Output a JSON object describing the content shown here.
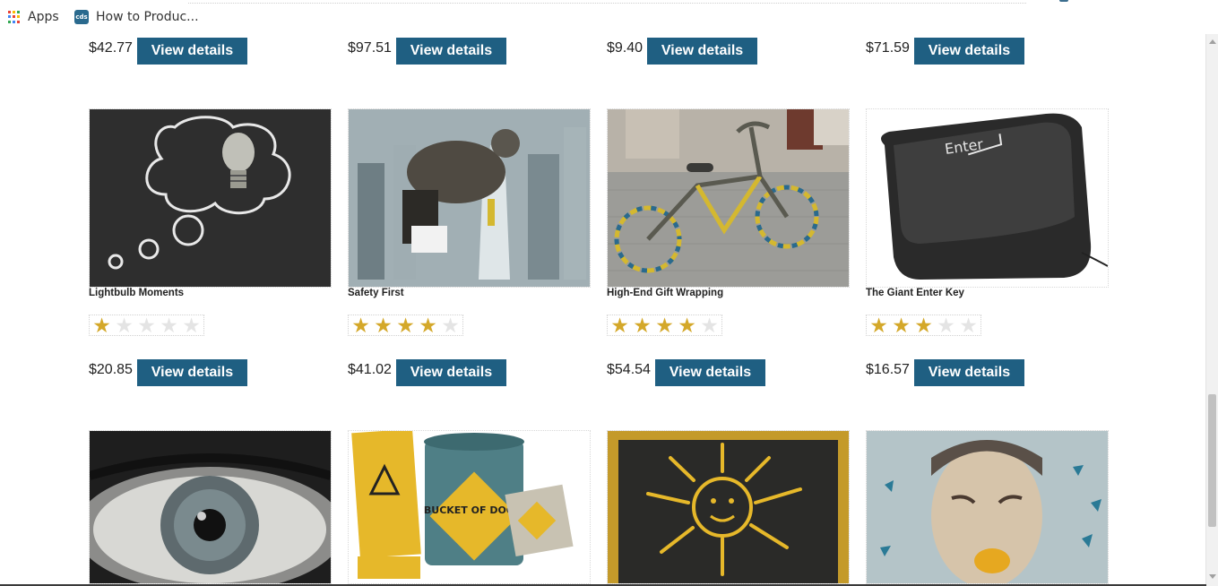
{
  "bookmarks": {
    "apps_label": "Apps",
    "tab_favicon": "cds",
    "tab_label": "How to Produc..."
  },
  "colors": {
    "button": "#1f5f82",
    "star_on": "#d4a82a",
    "star_off": "#e4e4e4"
  },
  "top_row": [
    {
      "price": "$42.77",
      "button": "View details"
    },
    {
      "price": "$97.51",
      "button": "View details"
    },
    {
      "price": "$9.40",
      "button": "View details"
    },
    {
      "price": "$71.59",
      "button": "View details"
    }
  ],
  "products": [
    {
      "title": "Lightbulb Moments",
      "rating": 1,
      "price": "$20.85",
      "button": "View details",
      "image": "lightbulb-thought-bubble-image"
    },
    {
      "title": "Safety First",
      "rating": 4,
      "price": "$41.02",
      "button": "View details",
      "image": "city-rooftop-image"
    },
    {
      "title": "High-End Gift Wrapping",
      "rating": 4,
      "price": "$54.54",
      "button": "View details",
      "image": "knitted-bicycle-image"
    },
    {
      "title": "The Giant Enter Key",
      "rating": 3,
      "price": "$16.57",
      "button": "View details",
      "image": "enter-key-cushion-image"
    }
  ],
  "bottom_row": [
    {
      "image": "eye-closeup-image"
    },
    {
      "image": "bucket-of-doom-image",
      "text": "BUCKET OF DOOM"
    },
    {
      "image": "sun-chalkboard-image"
    },
    {
      "image": "sour-face-man-image"
    }
  ]
}
